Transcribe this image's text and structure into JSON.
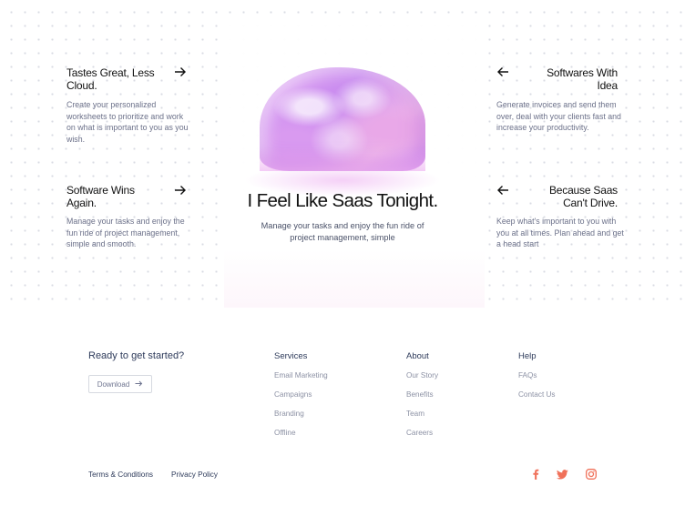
{
  "hero": {
    "title": "I Feel Like Saas Tonight.",
    "subtitle": "Manage your tasks and enjoy the fun ride of project management, simple"
  },
  "features": [
    {
      "title": "Tastes Great, Less Cloud.",
      "desc": "Create your personalized worksheets to prioritize and work on what is important to you as you wish."
    },
    {
      "title": "Softwares With Idea",
      "desc": "Generate invoices and send them over, deal with your clients fast and increase your productivity."
    },
    {
      "title": "Software Wins Again.",
      "desc": "Manage your tasks and enjoy the fun ride of project management, simple and smooth."
    },
    {
      "title": "Because Saas Can't Drive.",
      "desc": "Keep what's important to you with you at all times. Plan ahead and get a head start"
    }
  ],
  "footer": {
    "cta_title": "Ready to get started?",
    "download_label": "Download",
    "columns": [
      {
        "heading": "Services",
        "links": [
          "Email Marketing",
          "Campaigns",
          "Branding",
          "Offline"
        ]
      },
      {
        "heading": "About",
        "links": [
          "Our Story",
          "Benefits",
          "Team",
          "Careers"
        ]
      },
      {
        "heading": "Help",
        "links": [
          "FAQs",
          "Contact Us"
        ]
      }
    ],
    "legal": [
      "Terms & Conditions",
      "Privacy Policy"
    ],
    "social_icons": [
      "facebook-icon",
      "twitter-icon",
      "instagram-icon"
    ],
    "social_color": "#f0715a"
  }
}
